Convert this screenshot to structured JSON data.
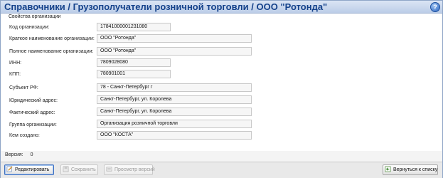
{
  "window": {
    "title": "Справочники / Грузополучатели розничной торговли / ООО \"Ротонда\"",
    "help_label": "?"
  },
  "section": {
    "title": "Свойства организации"
  },
  "fields": [
    {
      "label": "Код организации:",
      "value": "17841000001231080"
    },
    {
      "label": "Краткое наименование организации:",
      "value": "ООО \"Ротонда\""
    },
    {
      "label": "Полное наименование организации:",
      "value": "ООО \"Ротонда\""
    },
    {
      "label": "ИНН:",
      "value": "7809028080"
    },
    {
      "label": "КПП:",
      "value": "780901001"
    },
    {
      "label": "Субъект РФ:",
      "value": "78 - Санкт-Петербург г"
    },
    {
      "label": "Юридический адрес:",
      "value": "Санкт-Петербург, ул. Королева"
    },
    {
      "label": "Фактический адрес:",
      "value": "Санкт-Петербург, ул. Королева"
    },
    {
      "label": "Группа организации:",
      "value": "Организация розничной торговли"
    },
    {
      "label": "Кем создано:",
      "value": "ООО \"КОСТА\""
    }
  ],
  "version": {
    "label": "Версия:",
    "value": "0"
  },
  "toolbar": {
    "edit_label": "Редактировать",
    "save_label": "Сохранить",
    "history_label": "Просмотр версий",
    "back_label": "Вернуться к списку"
  }
}
